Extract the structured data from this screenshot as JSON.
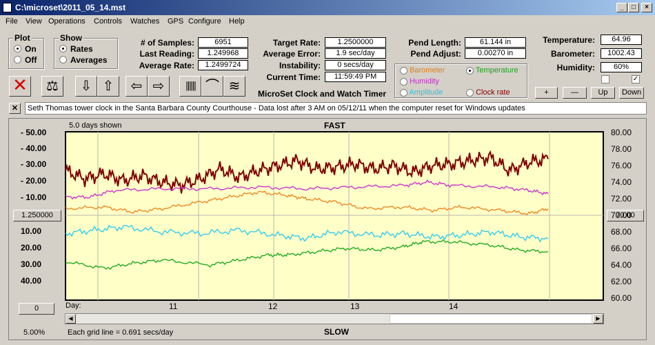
{
  "window": {
    "title": "C:\\microset\\2011_05_14.mst"
  },
  "menu": [
    "File",
    "View",
    "Operations",
    "Controls",
    "Watches",
    "GPS",
    "Configure",
    "Help"
  ],
  "plot": {
    "title": "Plot",
    "on": "On",
    "off": "Off"
  },
  "show": {
    "title": "Show",
    "rates": "Rates",
    "averages": "Averages"
  },
  "stats": {
    "samples_label": "# of Samples:",
    "samples": "6951",
    "last_label": "Last Reading:",
    "last": "1.249968",
    "avg_label": "Average Rate:",
    "avg": "1.2499724"
  },
  "rates": {
    "target_label": "Target Rate:",
    "target": "1.2500000",
    "error_label": "Average Error:",
    "error": "1.9 sec/day",
    "instab_label": "Instability:",
    "instab": "0 secs/day",
    "time_label": "Current Time:",
    "time": "11:59:49 PM"
  },
  "pend": {
    "length_label": "Pend Length:",
    "length": "61.144 in",
    "adjust_label": "Pend Adjust:",
    "adjust": "0.00270 in"
  },
  "env": {
    "temp_label": "Temperature:",
    "temp": "64.96",
    "baro_label": "Barometer:",
    "baro": "1002.43",
    "hum_label": "Humidity:",
    "hum": "60%"
  },
  "series_opts": {
    "barometer": "Barometer",
    "temperature": "Temperature",
    "humidity": "Humidity",
    "amplitude": "Amplitude",
    "clockrate": "Clock rate"
  },
  "app_title": "MicroSet Clock and Watch Timer",
  "buttons": {
    "plus": "+",
    "minus": "—",
    "up": "Up",
    "down": "Down"
  },
  "note": "Seth Thomas tower clock in the Santa Barbara County Courthouse - Data lost after 3 AM on 05/12/11 when the computer reset for Windows updates",
  "chart": {
    "days_shown": "5.0 days shown",
    "top": "FAST",
    "bottom": "SLOW",
    "left_btn": "1.250000",
    "right_btn": "70.00",
    "zero_btn": "0",
    "pct": "5.00%",
    "grid_note": "Each grid line = 0.691 secs/day",
    "day_label": "Day:"
  },
  "chart_data": {
    "type": "line",
    "left_ticks": [
      "- 50.00",
      "- 40.00",
      "- 30.00",
      "- 20.00",
      "- 10.00",
      "10.00",
      "20.00",
      "30.00",
      "40.00"
    ],
    "right_ticks": [
      "80.00",
      "78.00",
      "76.00",
      "74.00",
      "72.00",
      "70.00",
      "68.00",
      "66.00",
      "64.00",
      "62.00",
      "60.00"
    ],
    "x_ticks": [
      "11",
      "12",
      "13",
      "14"
    ],
    "series": [
      {
        "color": "#800000",
        "x": [
          0,
          4,
          8,
          12,
          16,
          20,
          24,
          28,
          32,
          36,
          40,
          44,
          48,
          52,
          56,
          60,
          64,
          68,
          72,
          76,
          80,
          84,
          88,
          92,
          96,
          100
        ],
        "y": [
          27,
          22,
          25,
          21,
          24,
          20,
          18,
          22,
          28,
          23,
          27,
          30,
          33,
          28,
          29,
          31,
          28,
          30,
          26,
          30,
          31,
          33,
          35,
          27,
          32,
          34
        ]
      },
      {
        "color": "#cc33cc",
        "x": [
          0,
          5,
          10,
          20,
          30,
          40,
          50,
          60,
          70,
          75,
          80,
          90,
          96,
          100
        ],
        "y": [
          11,
          11,
          15,
          16,
          16,
          17,
          16,
          17,
          18,
          20,
          18,
          17,
          15,
          13
        ]
      },
      {
        "color": "#ee8822",
        "x": [
          0,
          8,
          14,
          20,
          28,
          34,
          40,
          46,
          50,
          56,
          62,
          70,
          76,
          82,
          90,
          96,
          100
        ],
        "y": [
          4,
          5,
          2,
          4,
          8,
          11,
          14,
          12,
          10,
          8,
          4,
          5,
          3,
          5,
          3,
          1,
          4
        ]
      },
      {
        "color": "#33ccee",
        "x": [
          0,
          6,
          12,
          20,
          28,
          36,
          44,
          50,
          56,
          64,
          70,
          76,
          82,
          88,
          94,
          100
        ],
        "y": [
          -11,
          -9,
          -7,
          -10,
          -11,
          -9,
          -12,
          -14,
          -10,
          -12,
          -11,
          -13,
          -12,
          -10,
          -13,
          -14
        ]
      },
      {
        "color": "#22aa22",
        "x": [
          0,
          8,
          14,
          20,
          30,
          36,
          42,
          46,
          52,
          58,
          64,
          70,
          74,
          80,
          88,
          94,
          100
        ],
        "y": [
          -28,
          -32,
          -29,
          -27,
          -30,
          -27,
          -24,
          -24,
          -22,
          -20,
          -21,
          -19,
          -16,
          -16,
          -18,
          -21,
          -22
        ]
      }
    ]
  }
}
